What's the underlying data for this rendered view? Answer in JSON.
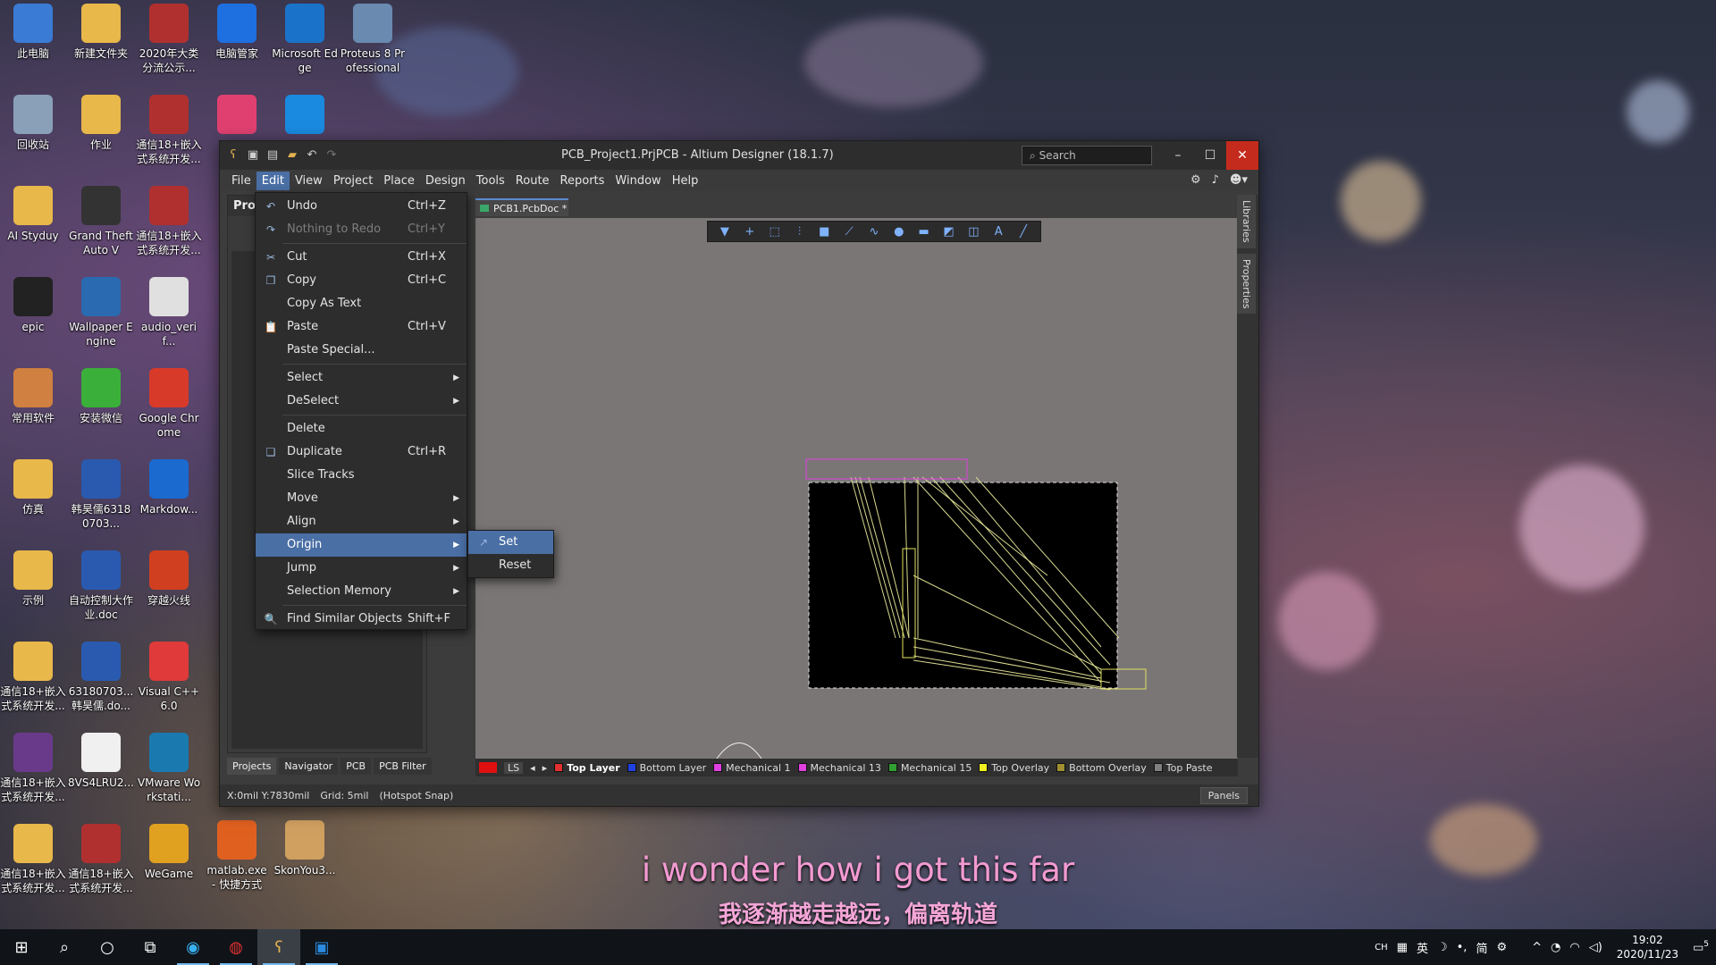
{
  "desktop": {
    "icons": [
      {
        "label": "此电脑",
        "icon": "computer-icon",
        "color": "#3a7bd5"
      },
      {
        "label": "新建文件夹",
        "icon": "folder-icon",
        "color": "#e8b84a"
      },
      {
        "label": "2020年大类分流公示...",
        "icon": "winrar-icon",
        "color": "#b03030"
      },
      {
        "label": "电脑管家",
        "icon": "shield-icon",
        "color": "#1e6fe0"
      },
      {
        "label": "Microsoft Edge",
        "icon": "edge-icon",
        "color": "#1a73c9"
      },
      {
        "label": "Proteus 8 Professional",
        "icon": "proteus-icon",
        "color": "#6a8ab0"
      },
      {
        "label": "回收站",
        "icon": "recycle-bin-icon",
        "color": "#8aa0b8"
      },
      {
        "label": "作业",
        "icon": "folder-icon",
        "color": "#e8b84a"
      },
      {
        "label": "通信18+嵌入式系统开发...",
        "icon": "winrar-icon",
        "color": "#b03030"
      },
      {
        "label": "",
        "icon": "pinwheel-icon",
        "color": "#e04070"
      },
      {
        "label": "",
        "icon": "qq-browser-icon",
        "color": "#1a8ae0"
      },
      {
        "label": "AI Styduy",
        "icon": "folder-icon",
        "color": "#e8b84a"
      },
      {
        "label": "Grand Theft Auto V",
        "icon": "gta-icon",
        "color": "#333333"
      },
      {
        "label": "通信18+嵌入式系统开发...",
        "icon": "winrar-icon",
        "color": "#b03030"
      },
      {
        "label": "epic",
        "icon": "epic-icon",
        "color": "#222222"
      },
      {
        "label": "Wallpaper Engine",
        "icon": "wallpaper-engine-icon",
        "color": "#2a6ab0"
      },
      {
        "label": "audio_verif...",
        "icon": "wav-icon",
        "color": "#e0e0e0"
      },
      {
        "label": "常用软件",
        "icon": "folder-icon",
        "color": "#d08040"
      },
      {
        "label": "安装微信",
        "icon": "wechat-icon",
        "color": "#3ab03a"
      },
      {
        "label": "Google Chrome",
        "icon": "chrome-icon",
        "color": "#d83a2a"
      },
      {
        "label": "仿真",
        "icon": "folder-icon",
        "color": "#e8b84a"
      },
      {
        "label": "韩昊儒63180703...",
        "icon": "word-icon",
        "color": "#2a5ab0"
      },
      {
        "label": "Markdow...",
        "icon": "markdown-icon",
        "color": "#1a6ad0"
      },
      {
        "label": "示例",
        "icon": "folder-icon",
        "color": "#e8b84a"
      },
      {
        "label": "自动控制大作业.doc",
        "icon": "word-icon",
        "color": "#2a5ab0"
      },
      {
        "label": "穿越火线",
        "icon": "crossfire-icon",
        "color": "#d04020"
      },
      {
        "label": "通信18+嵌入式系统开发...",
        "icon": "folder-icon",
        "color": "#e8b84a"
      },
      {
        "label": "63180703...韩昊儒.do...",
        "icon": "word-icon",
        "color": "#2a5ab0"
      },
      {
        "label": "Visual C++ 6.0",
        "icon": "visual-cpp-icon",
        "color": "#e03a3a"
      },
      {
        "label": "通信18+嵌入式系统开发...",
        "icon": "winrar-icon",
        "color": "#6a3a8a"
      },
      {
        "label": "8VS4LRU2...",
        "icon": "image-file-icon",
        "color": "#f0f0f0"
      },
      {
        "label": "VMware Workstati...",
        "icon": "vmware-icon",
        "color": "#1a7ab0"
      },
      {
        "label": "通信18+嵌入式系统开发...",
        "icon": "folder-icon",
        "color": "#e8b84a"
      },
      {
        "label": "通信18+嵌入式系统开发...",
        "icon": "winrar-icon",
        "color": "#b03030"
      },
      {
        "label": "WeGame",
        "icon": "wegame-icon",
        "color": "#e0a020"
      },
      {
        "label": "matlab.exe - 快捷方式",
        "icon": "matlab-icon",
        "color": "#e06020"
      },
      {
        "label": "SkonYou3...",
        "icon": "package-icon",
        "color": "#d0a060"
      }
    ]
  },
  "window": {
    "title": "PCB_Project1.PrjPCB - Altium Designer (18.1.7)",
    "search_placeholder": "Search",
    "menu": [
      "File",
      "Edit",
      "View",
      "Project",
      "Place",
      "Design",
      "Tools",
      "Route",
      "Reports",
      "Window",
      "Help"
    ],
    "active_menu": "Edit",
    "left_panel_title": "Proje",
    "doc_tab": "PCB1.PcbDoc *",
    "right_strip": [
      "Libraries",
      "Properties"
    ],
    "panel_tabs": [
      "Projects",
      "Navigator",
      "PCB",
      "PCB Filter"
    ],
    "layer_ls": "LS",
    "layers": [
      {
        "name": "Top Layer",
        "color": "#e03030"
      },
      {
        "name": "Bottom Layer",
        "color": "#2040e0"
      },
      {
        "name": "Mechanical 1",
        "color": "#e040e0"
      },
      {
        "name": "Mechanical 13",
        "color": "#e040e0"
      },
      {
        "name": "Mechanical 15",
        "color": "#30a030"
      },
      {
        "name": "Top Overlay",
        "color": "#f0f020"
      },
      {
        "name": "Bottom Overlay",
        "color": "#a09030"
      },
      {
        "name": "Top Paste",
        "color": "#808080"
      }
    ],
    "status": {
      "coords": "X:0mil Y:7830mil",
      "grid": "Grid: 5mil",
      "snap": "(Hotspot Snap)",
      "panels_btn": "Panels"
    }
  },
  "edit_menu": {
    "items": [
      {
        "label": "Undo",
        "shortcut": "Ctrl+Z",
        "icon": "undo-icon"
      },
      {
        "label": "Nothing to Redo",
        "shortcut": "Ctrl+Y",
        "icon": "redo-icon",
        "disabled": true
      },
      {
        "sep": true
      },
      {
        "label": "Cut",
        "shortcut": "Ctrl+X",
        "icon": "cut-icon"
      },
      {
        "label": "Copy",
        "shortcut": "Ctrl+C",
        "icon": "copy-icon"
      },
      {
        "label": "Copy As Text",
        "shortcut": ""
      },
      {
        "label": "Paste",
        "shortcut": "Ctrl+V",
        "icon": "paste-icon"
      },
      {
        "label": "Paste Special...",
        "shortcut": ""
      },
      {
        "sep": true
      },
      {
        "label": "Select",
        "submenu": true
      },
      {
        "label": "DeSelect",
        "submenu": true
      },
      {
        "sep": true
      },
      {
        "label": "Delete",
        "shortcut": ""
      },
      {
        "label": "Duplicate",
        "shortcut": "Ctrl+R",
        "icon": "duplicate-icon"
      },
      {
        "label": "Slice Tracks",
        "shortcut": ""
      },
      {
        "label": "Move",
        "submenu": true
      },
      {
        "label": "Align",
        "submenu": true
      },
      {
        "label": "Origin",
        "submenu": true,
        "highlighted": true
      },
      {
        "label": "Jump",
        "submenu": true
      },
      {
        "label": "Selection Memory",
        "submenu": true
      },
      {
        "sep": true
      },
      {
        "label": "Find Similar Objects",
        "shortcut": "Shift+F",
        "icon": "find-similar-icon"
      }
    ],
    "origin_submenu": [
      {
        "label": "Set",
        "icon": "origin-set-icon",
        "highlighted": true
      },
      {
        "label": "Reset"
      }
    ]
  },
  "subtitles": {
    "en": "i wonder how i got this far",
    "zh": "我逐渐越走越远，偏离轨道"
  },
  "taskbar": {
    "ime": "CH",
    "tray_text": "英",
    "tray_text2": "简",
    "time": "19:02",
    "date": "2020/11/23",
    "notification_count": "5"
  }
}
